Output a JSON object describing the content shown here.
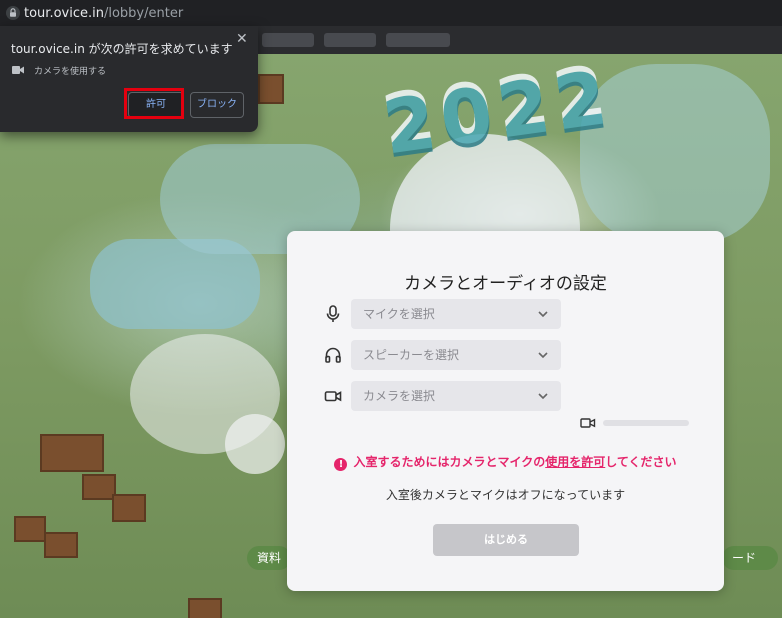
{
  "browser": {
    "url_host": "tour.ovice.in",
    "url_path": "/lobby/enter"
  },
  "permission_popup": {
    "title": "tour.ovice.in が次の許可を求めています",
    "permission_label": "カメラを使用する",
    "allow_label": "許可",
    "block_label": "ブロック",
    "close_glyph": "✕"
  },
  "scene": {
    "year_text": "2022",
    "left_chip": "資料",
    "right_chip": "ード"
  },
  "modal": {
    "title": "カメラとオーディオの設定",
    "mic_select": "マイクを選択",
    "speaker_select": "スピーカーを選択",
    "camera_select": "カメラを選択",
    "warning_prefix": "入室するためにはカメラとマイクの",
    "warning_link": "使用を許可",
    "warning_suffix": "してください",
    "note": "入室後カメラとマイクはオフになっています",
    "start_label": "はじめる",
    "icons": [
      "microphone-icon",
      "headphones-icon",
      "video-camera-icon",
      "chevron-down-icon",
      "alert-icon"
    ],
    "colors": {
      "warning": "#e5256b",
      "highlight": "#e4000f"
    }
  }
}
